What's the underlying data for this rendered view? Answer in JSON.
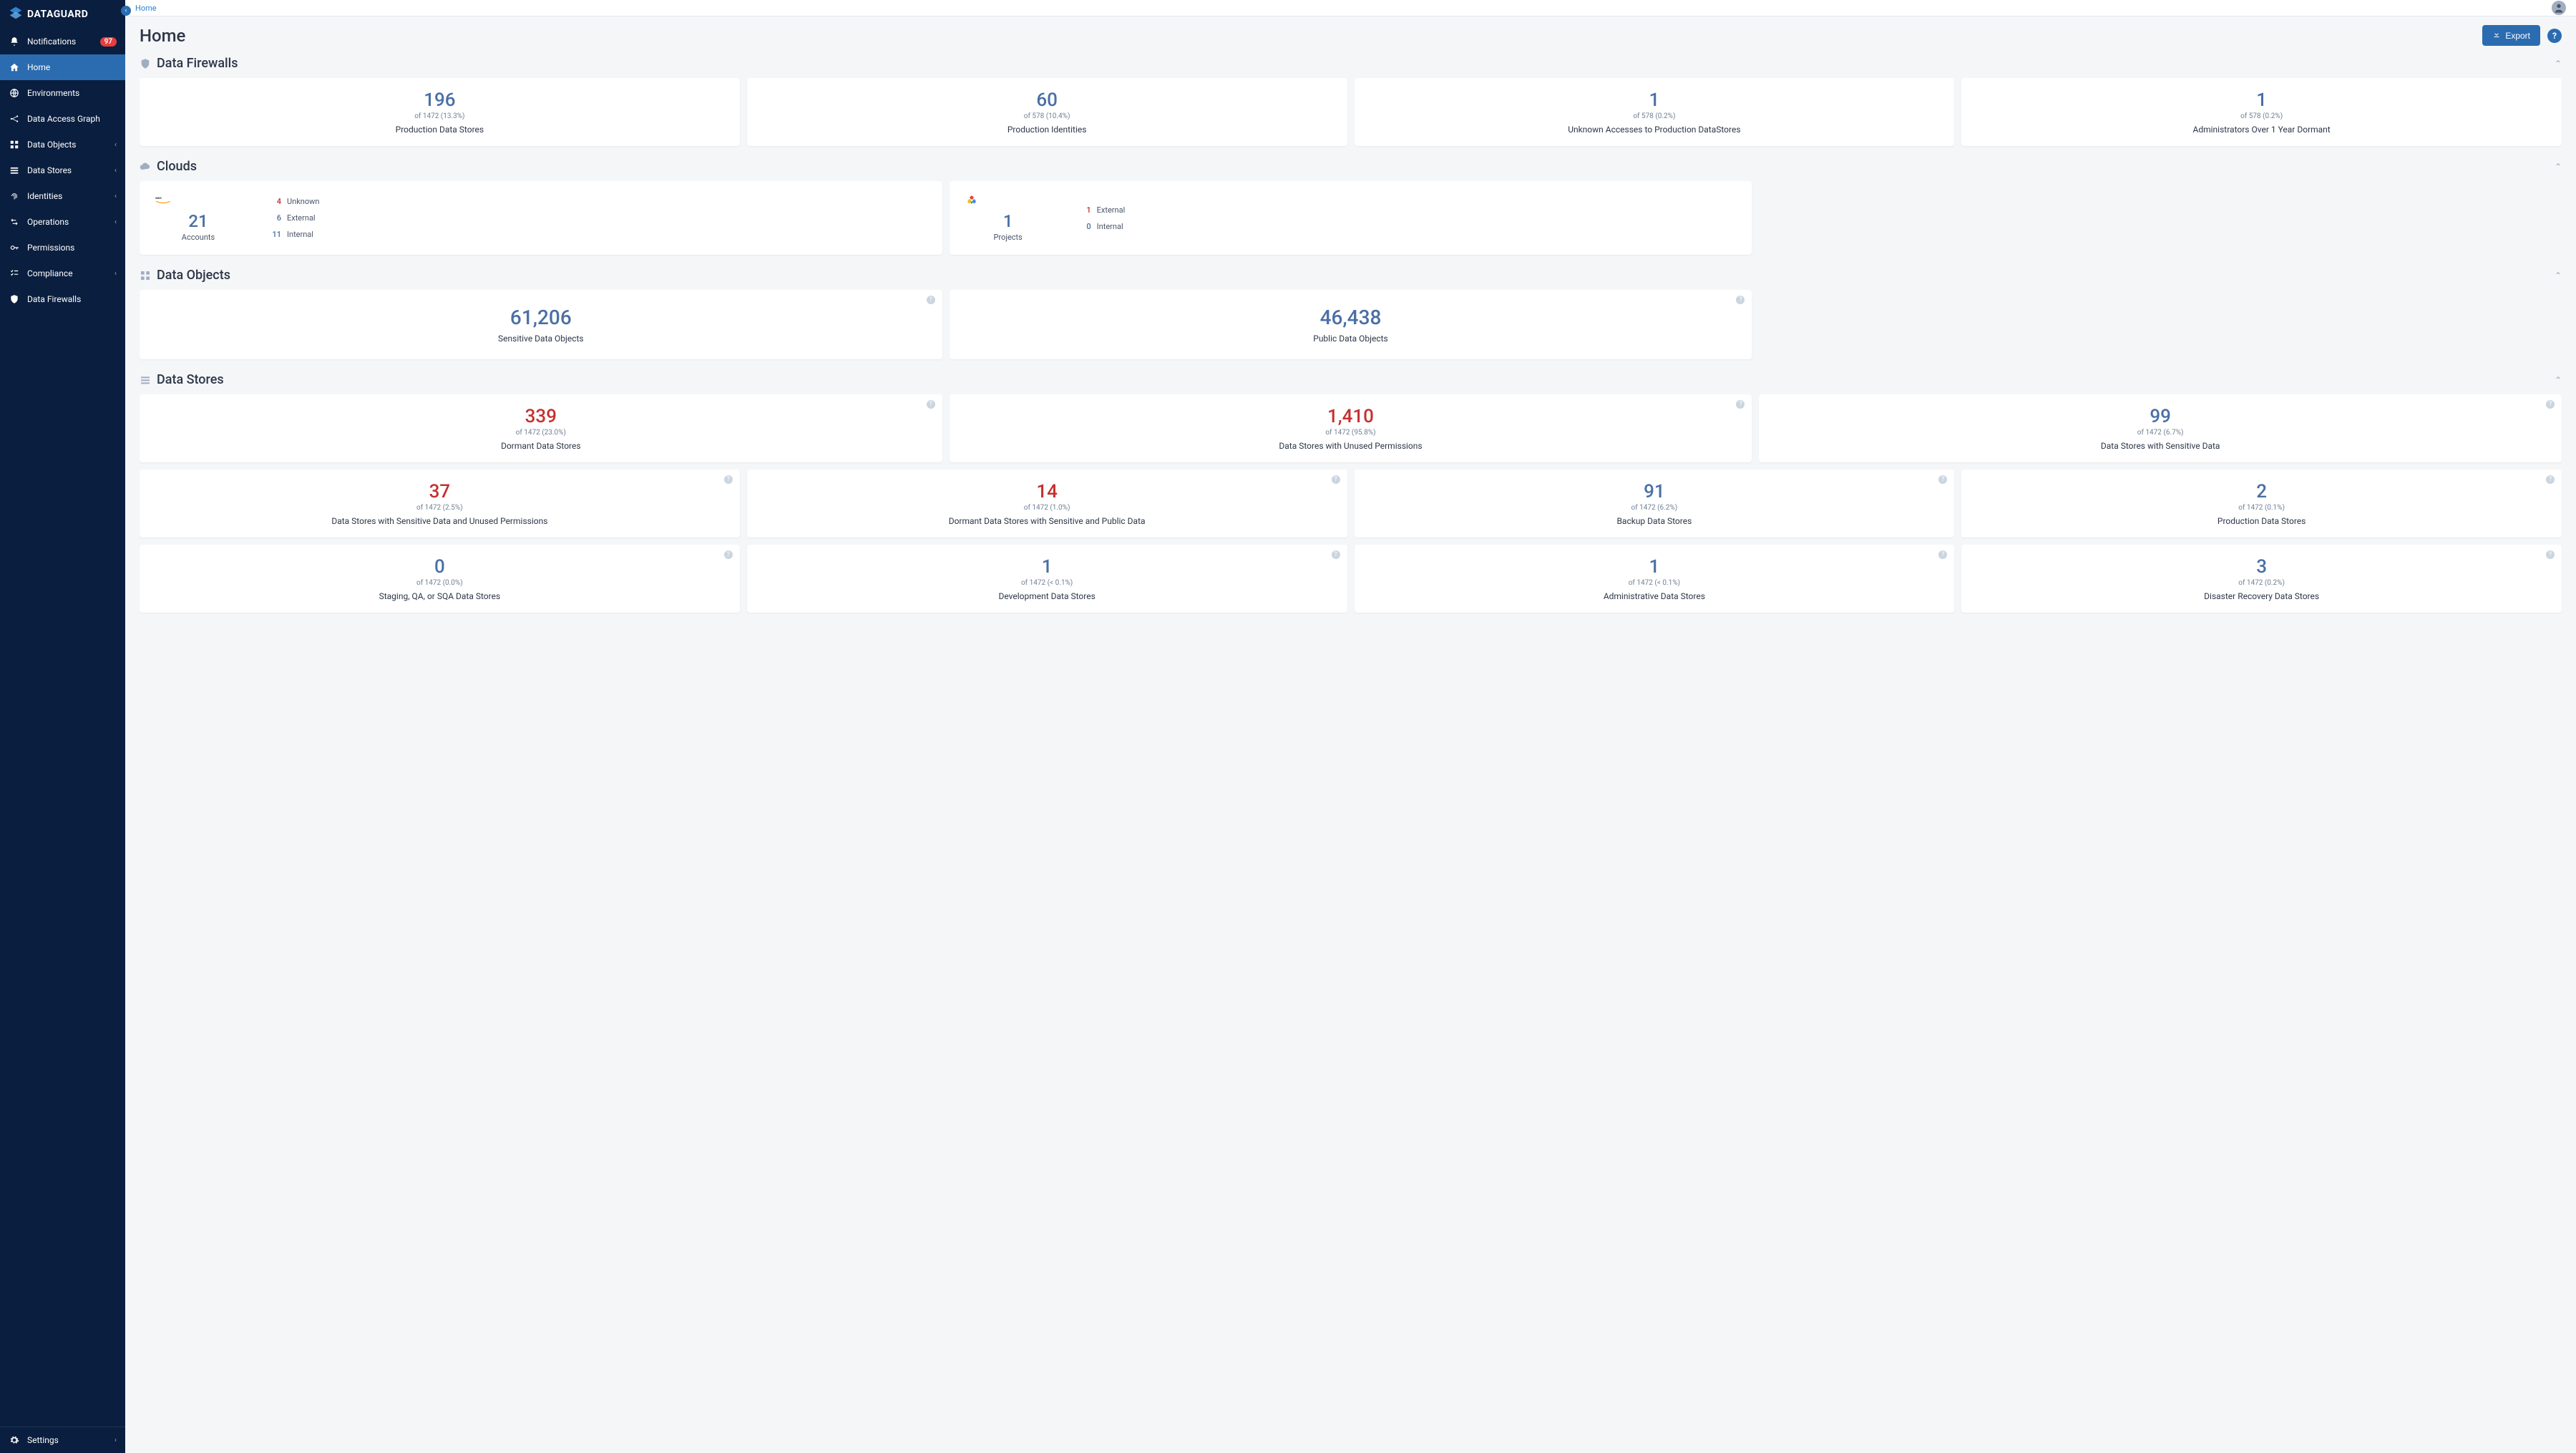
{
  "brand": "DATAGUARD",
  "breadcrumb": {
    "home": "Home"
  },
  "page_title": "Home",
  "export_label": "Export",
  "sidebar": {
    "notifications": {
      "label": "Notifications",
      "badge": "97"
    },
    "items": [
      {
        "label": "Home"
      },
      {
        "label": "Environments"
      },
      {
        "label": "Data Access Graph"
      },
      {
        "label": "Data Objects"
      },
      {
        "label": "Data Stores"
      },
      {
        "label": "Identities"
      },
      {
        "label": "Operations"
      },
      {
        "label": "Permissions"
      },
      {
        "label": "Compliance"
      },
      {
        "label": "Data Firewalls"
      }
    ],
    "settings": "Settings"
  },
  "sections": {
    "firewalls": {
      "title": "Data Firewalls",
      "cards": [
        {
          "value": "196",
          "sub": "of 1472 (13.3%)",
          "label": "Production Data Stores"
        },
        {
          "value": "60",
          "sub": "of 578 (10.4%)",
          "label": "Production Identities"
        },
        {
          "value": "1",
          "sub": "of 578 (0.2%)",
          "label": "Unknown Accesses to Production DataStores"
        },
        {
          "value": "1",
          "sub": "of 578 (0.2%)",
          "label": "Administrators Over 1 Year Dormant"
        }
      ]
    },
    "clouds": {
      "title": "Clouds",
      "aws": {
        "count": "21",
        "count_label": "Accounts",
        "unknown_n": "4",
        "unknown_l": "Unknown",
        "external_n": "6",
        "external_l": "External",
        "internal_n": "11",
        "internal_l": "Internal"
      },
      "gcp": {
        "count": "1",
        "count_label": "Projects",
        "external_n": "1",
        "external_l": "External",
        "internal_n": "0",
        "internal_l": "Internal"
      }
    },
    "data_objects": {
      "title": "Data Objects",
      "cards": [
        {
          "value": "61,206",
          "label": "Sensitive Data Objects"
        },
        {
          "value": "46,438",
          "label": "Public Data Objects"
        }
      ]
    },
    "data_stores": {
      "title": "Data Stores",
      "row1": [
        {
          "value": "339",
          "sub": "of 1472 (23.0%)",
          "label": "Dormant Data Stores"
        },
        {
          "value": "1,410",
          "sub": "of 1472 (95.8%)",
          "label": "Data Stores with Unused Permissions"
        },
        {
          "value": "99",
          "sub": "of 1472 (6.7%)",
          "label": "Data Stores with Sensitive Data"
        }
      ],
      "row2": [
        {
          "value": "37",
          "sub": "of 1472 (2.5%)",
          "label": "Data Stores with Sensitive Data and Unused Permissions"
        },
        {
          "value": "14",
          "sub": "of 1472 (1.0%)",
          "label": "Dormant Data Stores with Sensitive and Public Data"
        },
        {
          "value": "91",
          "sub": "of 1472 (6.2%)",
          "label": "Backup Data Stores"
        },
        {
          "value": "2",
          "sub": "of 1472 (0.1%)",
          "label": "Production Data Stores"
        }
      ],
      "row3": [
        {
          "value": "0",
          "sub": "of 1472 (0.0%)",
          "label": "Staging, QA, or SQA Data Stores"
        },
        {
          "value": "1",
          "sub": "of 1472 (< 0.1%)",
          "label": "Development Data Stores"
        },
        {
          "value": "1",
          "sub": "of 1472 (< 0.1%)",
          "label": "Administrative Data Stores"
        },
        {
          "value": "3",
          "sub": "of 1472 (0.2%)",
          "label": "Disaster Recovery Data Stores"
        }
      ]
    }
  }
}
